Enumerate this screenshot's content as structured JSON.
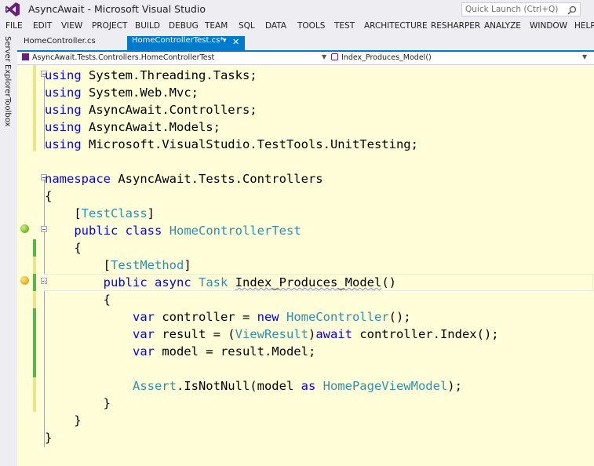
{
  "window": {
    "title": "AsyncAwait - Microsoft Visual Studio"
  },
  "quick_launch": {
    "placeholder": "Quick Launch (Ctrl+Q)"
  },
  "menu": [
    "FILE",
    "EDIT",
    "VIEW",
    "PROJECT",
    "BUILD",
    "DEBUG",
    "TEAM",
    "SQL",
    "DATA",
    "TOOLS",
    "TEST",
    "ARCHITECTURE",
    "RESHARPER",
    "ANALYZE",
    "WINDOW",
    "HELP"
  ],
  "side_tabs": [
    "Server Explorer",
    "Toolbox"
  ],
  "tabs": [
    {
      "label": "HomeController.cs"
    },
    {
      "label": "HomeControllerTest.cs*"
    }
  ],
  "navbar": {
    "class_path": "AsyncAwait.Tests.Controllers.HomeControllerTest",
    "member": "Index_Produces_Model()"
  },
  "code": [
    [
      [
        "kw",
        "using"
      ],
      [
        "t",
        " System.Threading.Tasks;"
      ]
    ],
    [
      [
        "kw",
        "using"
      ],
      [
        "t",
        " System.Web.Mvc;"
      ]
    ],
    [
      [
        "kw",
        "using"
      ],
      [
        "t",
        " AsyncAwait.Controllers;"
      ]
    ],
    [
      [
        "kw",
        "using"
      ],
      [
        "t",
        " AsyncAwait.Models;"
      ]
    ],
    [
      [
        "kw",
        "using"
      ],
      [
        "t",
        " Microsoft.VisualStudio.TestTools.UnitTesting;"
      ]
    ],
    [],
    [
      [
        "kw",
        "namespace"
      ],
      [
        "t",
        " AsyncAwait.Tests.Controllers"
      ]
    ],
    [
      [
        "t",
        "{"
      ]
    ],
    [
      [
        "t",
        "    ["
      ],
      [
        "ty",
        "TestClass"
      ],
      [
        "t",
        "]"
      ]
    ],
    [
      [
        "t",
        "    "
      ],
      [
        "kw",
        "public"
      ],
      [
        "t",
        " "
      ],
      [
        "kw",
        "class"
      ],
      [
        "t",
        " "
      ],
      [
        "ty",
        "HomeControllerTest"
      ]
    ],
    [
      [
        "t",
        "    {"
      ]
    ],
    [
      [
        "t",
        "        ["
      ],
      [
        "ty",
        "TestMethod"
      ],
      [
        "t",
        "]"
      ]
    ],
    [
      [
        "t",
        "        "
      ],
      [
        "kw",
        "public"
      ],
      [
        "t",
        " "
      ],
      [
        "kw",
        "async"
      ],
      [
        "t",
        " "
      ],
      [
        "ty",
        "Task"
      ],
      [
        "t",
        " "
      ],
      [
        "sq",
        "Index_Produces_Model"
      ],
      [
        "t",
        "()"
      ]
    ],
    [
      [
        "t",
        "        {"
      ]
    ],
    [
      [
        "t",
        "            "
      ],
      [
        "kw",
        "var"
      ],
      [
        "t",
        " controller = "
      ],
      [
        "kw",
        "new"
      ],
      [
        "t",
        " "
      ],
      [
        "ty",
        "HomeController"
      ],
      [
        "t",
        "();"
      ]
    ],
    [
      [
        "t",
        "            "
      ],
      [
        "kw",
        "var"
      ],
      [
        "t",
        " result = ("
      ],
      [
        "ty",
        "ViewResult"
      ],
      [
        "t",
        ")"
      ],
      [
        "kw",
        "await"
      ],
      [
        "t",
        " controller.Index();"
      ]
    ],
    [
      [
        "t",
        "            "
      ],
      [
        "kw",
        "var"
      ],
      [
        "t",
        " model = result.Model;"
      ]
    ],
    [],
    [
      [
        "t",
        "            "
      ],
      [
        "ty",
        "Assert"
      ],
      [
        "t",
        ".IsNotNull(model "
      ],
      [
        "kw",
        "as"
      ],
      [
        "t",
        " "
      ],
      [
        "ty",
        "HomePageViewModel"
      ],
      [
        "t",
        ");"
      ]
    ],
    [
      [
        "t",
        "        }"
      ]
    ],
    [
      [
        "t",
        "    }"
      ]
    ],
    [
      [
        "t",
        "}"
      ]
    ]
  ],
  "colors": {
    "keyword": "#0000ff",
    "type": "#2b91af",
    "editor_bg": "#fffed8",
    "accent": "#007acc",
    "change_saved": "#57b84a",
    "change_unsaved": "#efe48a"
  }
}
